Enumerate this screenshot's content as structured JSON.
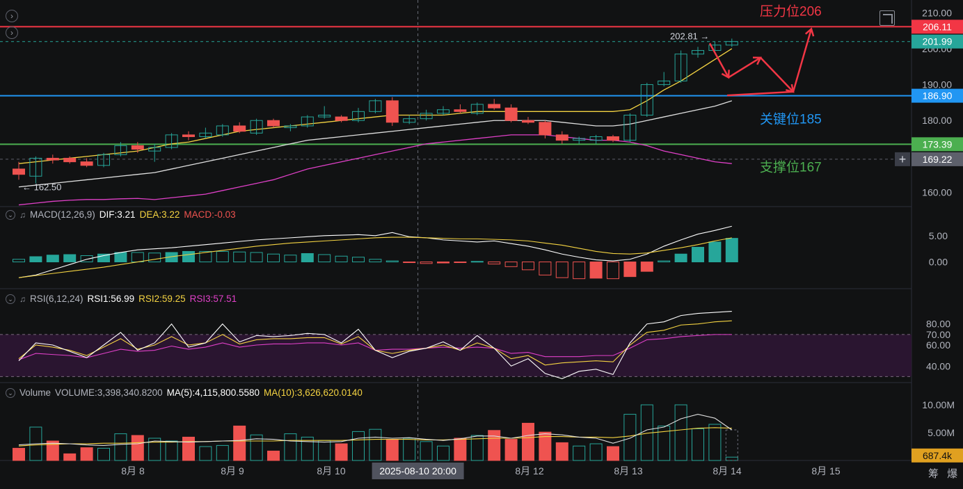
{
  "chart_data": [
    {
      "type": "candlestick",
      "panel": "price",
      "x_labels": [
        "8月 8",
        "8月 9",
        "8月 10",
        "8月 12",
        "8月 13",
        "8月 14",
        "8月 15"
      ],
      "crosshair_x_label": "2025-08-10 20:00",
      "y_ticks": [
        "210.00",
        "200.00",
        "190.00",
        "180.00",
        "160.00"
      ],
      "ylim": [
        157,
        212
      ],
      "candles": [
        {
          "o": 166.5,
          "h": 168.5,
          "l": 163.5,
          "c": 165.0
        },
        {
          "o": 164.5,
          "h": 170.0,
          "l": 162.5,
          "c": 169.5
        },
        {
          "o": 169.5,
          "h": 170.5,
          "l": 168.0,
          "c": 169.0
        },
        {
          "o": 169.5,
          "h": 170.0,
          "l": 168.0,
          "c": 168.5
        },
        {
          "o": 168.5,
          "h": 169.5,
          "l": 167.0,
          "c": 167.5
        },
        {
          "o": 167.5,
          "h": 171.0,
          "l": 167.0,
          "c": 170.5
        },
        {
          "o": 170.5,
          "h": 174.0,
          "l": 170.0,
          "c": 173.0
        },
        {
          "o": 173.0,
          "h": 174.0,
          "l": 171.0,
          "c": 172.0
        },
        {
          "o": 171.5,
          "h": 173.5,
          "l": 168.5,
          "c": 172.5
        },
        {
          "o": 172.5,
          "h": 176.5,
          "l": 172.0,
          "c": 176.0
        },
        {
          "o": 176.0,
          "h": 177.0,
          "l": 174.5,
          "c": 175.5
        },
        {
          "o": 175.5,
          "h": 178.0,
          "l": 175.0,
          "c": 176.5
        },
        {
          "o": 176.0,
          "h": 179.0,
          "l": 175.5,
          "c": 178.5
        },
        {
          "o": 178.5,
          "h": 179.5,
          "l": 176.5,
          "c": 177.0
        },
        {
          "o": 176.5,
          "h": 180.5,
          "l": 176.0,
          "c": 180.0
        },
        {
          "o": 180.0,
          "h": 180.5,
          "l": 178.0,
          "c": 178.5
        },
        {
          "o": 178.0,
          "h": 179.0,
          "l": 177.0,
          "c": 178.5
        },
        {
          "o": 178.5,
          "h": 181.5,
          "l": 178.0,
          "c": 181.0
        },
        {
          "o": 181.0,
          "h": 184.0,
          "l": 180.5,
          "c": 181.5
        },
        {
          "o": 181.0,
          "h": 181.5,
          "l": 179.5,
          "c": 180.0
        },
        {
          "o": 180.0,
          "h": 183.5,
          "l": 179.5,
          "c": 182.5
        },
        {
          "o": 182.5,
          "h": 186.0,
          "l": 182.0,
          "c": 185.5
        },
        {
          "o": 185.5,
          "h": 186.5,
          "l": 178.5,
          "c": 179.5
        },
        {
          "o": 179.5,
          "h": 181.5,
          "l": 179.0,
          "c": 180.5
        },
        {
          "o": 180.5,
          "h": 183.0,
          "l": 180.0,
          "c": 182.0
        },
        {
          "o": 182.0,
          "h": 184.0,
          "l": 181.5,
          "c": 183.0
        },
        {
          "o": 183.0,
          "h": 184.5,
          "l": 182.0,
          "c": 182.5
        },
        {
          "o": 182.0,
          "h": 185.0,
          "l": 181.5,
          "c": 184.5
        },
        {
          "o": 184.5,
          "h": 186.0,
          "l": 183.0,
          "c": 183.5
        },
        {
          "o": 183.5,
          "h": 184.5,
          "l": 179.5,
          "c": 180.0
        },
        {
          "o": 180.0,
          "h": 181.0,
          "l": 179.0,
          "c": 179.5
        },
        {
          "o": 179.5,
          "h": 180.0,
          "l": 175.0,
          "c": 176.0
        },
        {
          "o": 176.0,
          "h": 177.0,
          "l": 173.5,
          "c": 174.5
        },
        {
          "o": 174.5,
          "h": 175.5,
          "l": 173.5,
          "c": 175.0
        },
        {
          "o": 174.5,
          "h": 176.0,
          "l": 173.5,
          "c": 175.5
        },
        {
          "o": 175.5,
          "h": 176.0,
          "l": 174.0,
          "c": 174.5
        },
        {
          "o": 174.5,
          "h": 182.0,
          "l": 174.0,
          "c": 181.5
        },
        {
          "o": 181.5,
          "h": 190.5,
          "l": 181.0,
          "c": 190.0
        },
        {
          "o": 190.0,
          "h": 193.5,
          "l": 189.5,
          "c": 191.0
        },
        {
          "o": 191.0,
          "h": 199.5,
          "l": 190.5,
          "c": 198.5
        },
        {
          "o": 198.5,
          "h": 200.5,
          "l": 197.5,
          "c": 199.5
        },
        {
          "o": 199.5,
          "h": 202.0,
          "l": 199.0,
          "c": 201.0
        },
        {
          "o": 201.0,
          "h": 202.81,
          "l": 200.5,
          "c": 202.0
        }
      ],
      "ma_fast": [
        168.0,
        168.5,
        169.0,
        169.5,
        170.0,
        170.5,
        171.0,
        171.5,
        172.5,
        173.5,
        174.0,
        175.0,
        176.0,
        177.0,
        177.5,
        178.0,
        178.5,
        179.0,
        179.5,
        180.0,
        180.5,
        181.0,
        181.5,
        181.5,
        181.5,
        181.5,
        182.0,
        182.5,
        182.5,
        182.5,
        182.5,
        182.5,
        182.5,
        182.5,
        182.5,
        182.5,
        183.0,
        185.5,
        188.5,
        191.0,
        194.0,
        197.0,
        200.0
      ],
      "ma_mid": [
        161.5,
        162.0,
        162.5,
        163.0,
        163.5,
        164.0,
        164.5,
        165.0,
        165.5,
        166.5,
        167.5,
        168.5,
        169.5,
        170.5,
        171.5,
        172.5,
        173.5,
        174.5,
        175.0,
        175.5,
        176.0,
        176.5,
        177.0,
        177.5,
        178.0,
        178.5,
        179.0,
        179.5,
        180.0,
        180.0,
        180.0,
        180.0,
        179.5,
        179.0,
        178.5,
        178.5,
        179.0,
        180.0,
        181.0,
        182.0,
        183.0,
        184.0,
        185.5
      ],
      "ma_slow": [
        156.5,
        157.0,
        157.5,
        157.8,
        158.0,
        158.0,
        158.2,
        158.3,
        158.0,
        158.5,
        159.0,
        159.5,
        160.5,
        161.5,
        162.5,
        163.5,
        165.0,
        166.5,
        167.5,
        168.5,
        169.5,
        170.5,
        171.5,
        172.5,
        173.5,
        174.0,
        174.5,
        175.0,
        175.5,
        176.0,
        176.0,
        176.0,
        175.5,
        175.0,
        174.5,
        174.5,
        174.0,
        173.0,
        171.5,
        170.5,
        169.5,
        168.5,
        168.0
      ],
      "markers": {
        "high": "202.81 →",
        "low": "← 162.50"
      },
      "horizontal_lines": [
        {
          "value": 206.11,
          "label": "206.11",
          "color": "#f23645",
          "dashed": false
        },
        {
          "value": 201.99,
          "label": "201.99",
          "color": "#26a69a",
          "dashed": true
        },
        {
          "value": 186.9,
          "label": "186.90",
          "color": "#2196f3",
          "dashed": false
        },
        {
          "value": 173.39,
          "label": "173.39",
          "color": "#4caf50",
          "dashed": false
        },
        {
          "value": 169.22,
          "label": "169.22",
          "color": "#5d606b",
          "dashed": true
        }
      ],
      "annotations": [
        {
          "text": "压力位206",
          "color": "#f23645"
        },
        {
          "text": "关键位185",
          "color": "#2196f3"
        },
        {
          "text": "支撑位167",
          "color": "#4caf50"
        }
      ],
      "forecast_path": [
        201.5,
        192.0,
        197.5,
        188.0,
        205.5
      ]
    },
    {
      "type": "macd",
      "panel": "macd",
      "legend": {
        "name": "MACD(12,26,9)",
        "dif": "DIF:3.21",
        "dea": "DEA:3.22",
        "macd": "MACD:-0.03"
      },
      "y_ticks": [
        "5.00",
        "0.00"
      ],
      "ylim": [
        -5.5,
        7.5
      ],
      "hist": [
        0.5,
        1.0,
        1.3,
        1.4,
        1.2,
        1.5,
        1.8,
        1.8,
        1.7,
        1.8,
        2.0,
        2.0,
        2.0,
        1.9,
        1.8,
        1.5,
        1.3,
        1.6,
        1.4,
        1.1,
        0.9,
        0.5,
        0.2,
        -0.1,
        -0.3,
        -0.2,
        -0.1,
        0.1,
        -0.4,
        -0.9,
        -1.5,
        -2.5,
        -3.0,
        -3.2,
        -3.1,
        -3.2,
        -2.8,
        -1.8,
        0.2,
        1.5,
        2.8,
        3.8,
        4.5
      ],
      "dif": [
        -3.0,
        -2.5,
        -1.5,
        -0.5,
        0.5,
        1.2,
        1.8,
        2.3,
        2.5,
        2.7,
        3.0,
        3.3,
        3.6,
        3.9,
        4.2,
        4.4,
        4.6,
        4.8,
        5.0,
        5.1,
        5.2,
        5.0,
        5.6,
        4.8,
        4.6,
        4.2,
        4.0,
        3.8,
        4.0,
        3.5,
        3.0,
        2.3,
        1.5,
        0.9,
        0.4,
        0.2,
        0.5,
        1.5,
        3.0,
        4.2,
        5.3,
        6.0,
        6.8
      ],
      "dea": [
        -3.0,
        -2.6,
        -2.2,
        -1.8,
        -1.4,
        -1.0,
        -0.5,
        0.0,
        0.5,
        1.0,
        1.4,
        1.8,
        2.2,
        2.6,
        3.0,
        3.3,
        3.6,
        3.8,
        4.0,
        4.2,
        4.4,
        4.6,
        4.7,
        4.7,
        4.6,
        4.5,
        4.4,
        4.4,
        4.3,
        4.2,
        4.0,
        3.6,
        3.2,
        2.6,
        2.0,
        1.6,
        1.5,
        1.7,
        2.2,
        2.7,
        3.3,
        4.0,
        4.6
      ]
    },
    {
      "type": "rsi",
      "panel": "rsi",
      "legend": {
        "name": "RSI(6,12,24)",
        "rsi1": "RSI1:56.99",
        "rsi2": "RSI2:59.25",
        "rsi3": "RSI3:57.51"
      },
      "y_ticks": [
        "80.00",
        "70.00",
        "60.00",
        "40.00"
      ],
      "ylim": [
        23,
        97
      ],
      "band": [
        30,
        70
      ],
      "rsi1": [
        45,
        62,
        60,
        54,
        48,
        60,
        72,
        55,
        62,
        80,
        58,
        62,
        80,
        63,
        69,
        68,
        69,
        71,
        70,
        62,
        75,
        55,
        48,
        54,
        57,
        63,
        55,
        69,
        57,
        40,
        47,
        33,
        28,
        35,
        37,
        32,
        62,
        80,
        82,
        88,
        90,
        91,
        92
      ],
      "rsi2": [
        47,
        60,
        58,
        55,
        50,
        58,
        66,
        56,
        60,
        68,
        60,
        62,
        70,
        61,
        65,
        66,
        66,
        67,
        67,
        61,
        68,
        55,
        52,
        55,
        57,
        60,
        55,
        62,
        57,
        47,
        50,
        41,
        43,
        44,
        45,
        44,
        60,
        72,
        74,
        79,
        80,
        82,
        83
      ],
      "rsi3": [
        46,
        52,
        51,
        50,
        48,
        52,
        56,
        54,
        55,
        59,
        56,
        58,
        62,
        58,
        60,
        61,
        61,
        62,
        62,
        60,
        62,
        55,
        56,
        56,
        57,
        58,
        57,
        58,
        57,
        52,
        53,
        49,
        49,
        49,
        50,
        50,
        57,
        65,
        66,
        68,
        69,
        70,
        70
      ]
    },
    {
      "type": "volume",
      "panel": "volume",
      "legend": {
        "name": "Volume",
        "vol": "VOLUME:3,398,340.8200",
        "ma5": "MA(5):4,115,800.5580",
        "ma10": "MA(10):3,626,620.0140"
      },
      "y_ticks": [
        "10.00M",
        "5.00M"
      ],
      "current_value": "687.4k",
      "ylim": [
        0,
        11.5
      ],
      "volumes": [
        2.2,
        6.0,
        3.5,
        1.2,
        2.3,
        2.2,
        4.8,
        4.5,
        4.0,
        3.5,
        4.2,
        2.5,
        2.7,
        6.2,
        4.6,
        1.7,
        4.8,
        4.2,
        3.6,
        3.0,
        5.2,
        5.6,
        3.8,
        4.0,
        3.4,
        2.6,
        4.0,
        4.5,
        5.4,
        3.8,
        6.7,
        5.1,
        3.2,
        2.6,
        3.0,
        2.5,
        8.3,
        10.0,
        6.2,
        10.0,
        5.7,
        6.5,
        0.6
      ],
      "ma5": [
        2.8,
        3.0,
        3.1,
        3.0,
        2.8,
        2.7,
        2.9,
        3.0,
        3.5,
        3.4,
        3.3,
        3.4,
        3.5,
        3.6,
        3.9,
        3.8,
        3.5,
        3.4,
        3.3,
        3.4,
        4.0,
        4.2,
        4.0,
        4.1,
        3.8,
        3.6,
        3.9,
        4.4,
        4.4,
        4.0,
        4.5,
        4.8,
        4.6,
        4.2,
        4.0,
        3.1,
        4.0,
        5.5,
        6.0,
        7.5,
        8.3,
        7.6,
        5.5
      ],
      "ma10": [
        2.6,
        2.8,
        2.9,
        3.0,
        3.0,
        3.1,
        3.1,
        3.2,
        3.3,
        3.3,
        3.4,
        3.4,
        3.5,
        3.5,
        3.5,
        3.5,
        3.6,
        3.6,
        3.6,
        3.6,
        3.7,
        3.8,
        3.8,
        3.8,
        3.7,
        3.7,
        3.8,
        3.9,
        4.0,
        4.0,
        4.1,
        4.3,
        4.3,
        4.2,
        4.2,
        4.1,
        4.4,
        4.9,
        5.2,
        5.5,
        5.8,
        5.9,
        5.8
      ]
    }
  ],
  "ui": {
    "nav_left_1": "›",
    "nav_left_2": "›",
    "plus_button": "+",
    "corner_text": "筹 爆",
    "colors": {
      "up": "#26a69a",
      "down": "#ef5350",
      "ma_fast": "#f5d442",
      "ma_mid": "#e0e0e0",
      "ma_slow": "#e040c8",
      "dif": "#ffffff",
      "dea": "#f5d442",
      "rsi1": "#ffffff",
      "rsi2": "#f5d442",
      "rsi3": "#e040c8",
      "annotation_arrow": "#f23645"
    }
  }
}
